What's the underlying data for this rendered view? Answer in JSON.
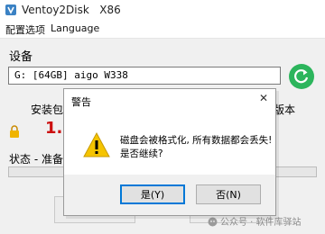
{
  "app": {
    "title": "Ventoy2Disk   X86"
  },
  "menu": [
    "配置选项",
    "Language"
  ],
  "device": {
    "label": "设备",
    "selected": "G: [64GB] aigo W338"
  },
  "version": {
    "left_label": "安装包",
    "right_label": "版本"
  },
  "step_number": "1.",
  "status": {
    "text": "状态 - 准备"
  },
  "watermark": "公众号 · 软件库驿站",
  "dialog": {
    "title": "警告",
    "message_line1": "磁盘会被格式化, 所有数据都会丢失!",
    "message_line2": "是否继续?",
    "yes_label": "是(Y)",
    "no_label": "否(N)"
  },
  "colors": {
    "refresh": "#2cb55c",
    "warning": "#f5c400",
    "focus": "#0078d7",
    "step_number": "#cc1010"
  }
}
